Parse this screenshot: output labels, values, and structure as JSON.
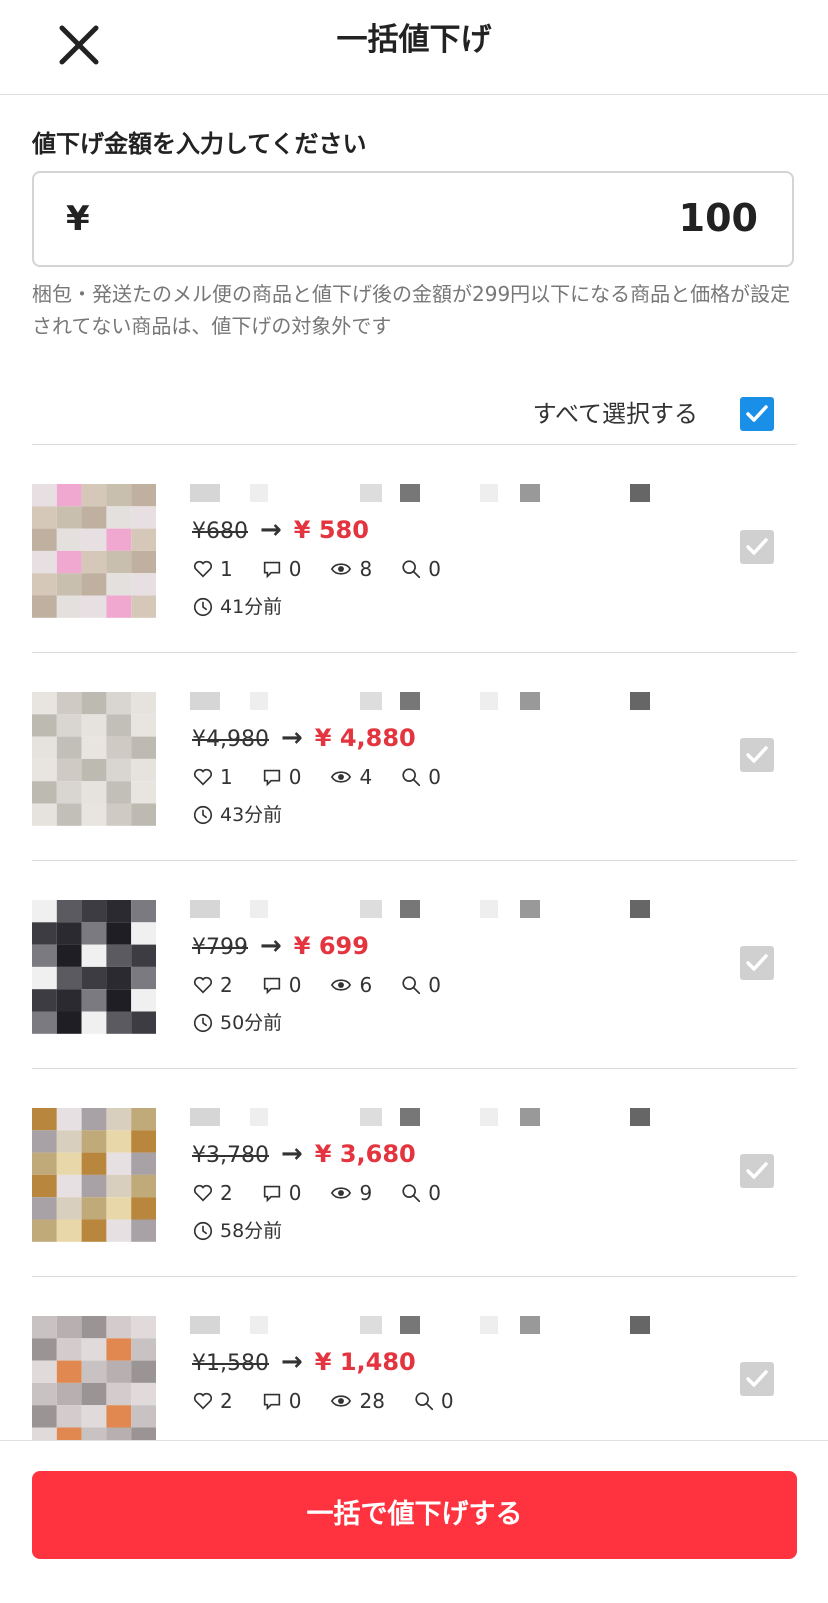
{
  "header": {
    "title": "一括値下げ"
  },
  "form": {
    "label": "値下げ金額を入力してください",
    "currency": "¥",
    "amount": "100",
    "note": "梱包・発送たのメル便の商品と値下げ後の金額が299円以下になる商品と価格が設定されてない商品は、値下げの対象外です"
  },
  "select_all": {
    "label": "すべて選択する",
    "checked": true
  },
  "items": [
    {
      "old_price": "¥680",
      "new_price": "¥ 580",
      "likes": "1",
      "comments": "0",
      "views": "8",
      "searches": "0",
      "time": "41分前"
    },
    {
      "old_price": "¥4,980",
      "new_price": "¥ 4,880",
      "likes": "1",
      "comments": "0",
      "views": "4",
      "searches": "0",
      "time": "43分前"
    },
    {
      "old_price": "¥799",
      "new_price": "¥ 699",
      "likes": "2",
      "comments": "0",
      "views": "6",
      "searches": "0",
      "time": "50分前"
    },
    {
      "old_price": "¥3,780",
      "new_price": "¥ 3,680",
      "likes": "2",
      "comments": "0",
      "views": "9",
      "searches": "0",
      "time": "58分前"
    },
    {
      "old_price": "¥1,580",
      "new_price": "¥ 1,480",
      "likes": "2",
      "comments": "0",
      "views": "28",
      "searches": "0",
      "time": ""
    }
  ],
  "footer": {
    "cta_label": "一括で値下げする"
  },
  "colors": {
    "accent": "#ff3340",
    "price_red": "#e3343f",
    "check_blue": "#1a8fe8",
    "check_grey": "#d0d0d0"
  }
}
